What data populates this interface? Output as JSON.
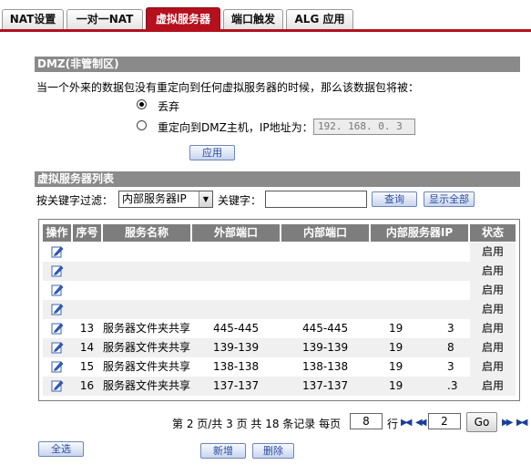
{
  "tabs": [
    "NAT设置",
    "一对一NAT",
    "虚拟服务器",
    "端口触发",
    "ALG 应用"
  ],
  "dmz": {
    "title": "DMZ(非管制区)",
    "description": "当一个外来的数据包没有重定向到任何虚拟服务器的时候，那么该数据包将被：",
    "option_discard": "丢弃",
    "option_redirect": "重定向到DMZ主机，IP地址为：",
    "ip_value": "192. 168. 0. 3",
    "apply_label": "应用"
  },
  "vs": {
    "title": "虚拟服务器列表",
    "filter_label": "按关键字过滤：",
    "filter_option": "内部服务器IP",
    "keyword_label": "关键字：",
    "keyword_value": "",
    "query_label": "查询",
    "show_all_label": "显示全部"
  },
  "table": {
    "headers": [
      "操作",
      "序号",
      "服务名称",
      "外部端口",
      "内部端口",
      "内部服务器IP",
      "状态"
    ],
    "rows": [
      {
        "index": "",
        "name": "",
        "ext": "",
        "int": "",
        "ip_start": "",
        "ip_end": "",
        "status": "启用"
      },
      {
        "index": "",
        "name": "",
        "ext": "",
        "int": "",
        "ip_start": "",
        "ip_end": "",
        "status": "启用"
      },
      {
        "index": "",
        "name": "",
        "ext": "",
        "int": "",
        "ip_start": "",
        "ip_end": "",
        "status": "启用"
      },
      {
        "index": "",
        "name": "",
        "ext": "",
        "int": "",
        "ip_start": "",
        "ip_end": "",
        "status": "启用"
      },
      {
        "index": "13",
        "name": "服务器文件夹共享",
        "ext": "445-445",
        "int": "445-445",
        "ip_start": "19",
        "ip_end": "3",
        "status": "启用"
      },
      {
        "index": "14",
        "name": "服务器文件夹共享",
        "ext": "139-139",
        "int": "139-139",
        "ip_start": "19",
        "ip_end": "8",
        "status": "启用"
      },
      {
        "index": "15",
        "name": "服务器文件夹共享",
        "ext": "138-138",
        "int": "138-138",
        "ip_start": "19",
        "ip_end": "3",
        "status": "启用"
      },
      {
        "index": "16",
        "name": "服务器文件夹共享",
        "ext": "137-137",
        "int": "137-137",
        "ip_start": "19",
        "ip_end": ".3",
        "status": "启用"
      }
    ]
  },
  "pagination": {
    "summary": "第 2 页/共 3 页 共 18 条记录 每页",
    "per_page": "8",
    "row_label": "行",
    "page_input": "2",
    "go_label": "Go"
  },
  "footer": {
    "select_all": "全选",
    "add": "新增",
    "delete": "删除"
  },
  "colors": {
    "active_tab": "#b5101d",
    "section_header": "#8a8a8a",
    "table_header": "#7d7d7d",
    "button_text": "#2a4aa0"
  }
}
